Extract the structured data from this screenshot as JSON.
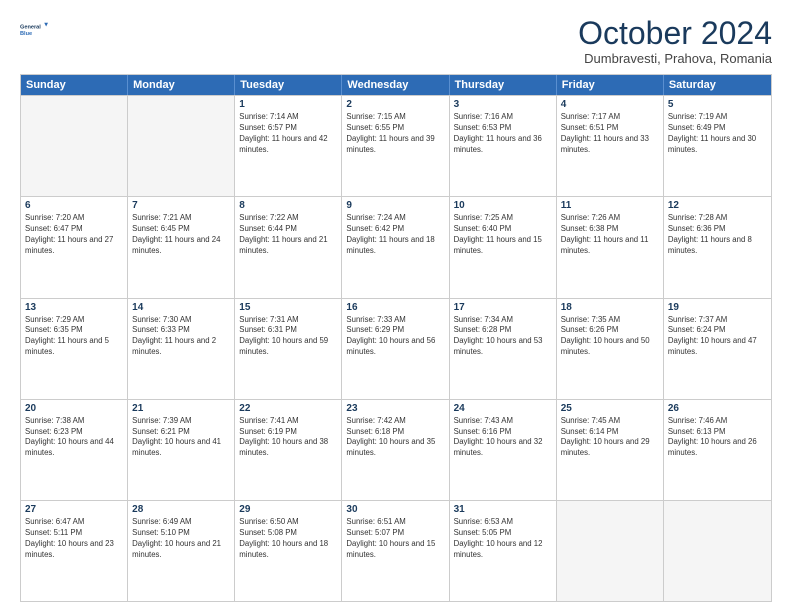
{
  "logo": {
    "line1": "General",
    "line2": "Blue"
  },
  "title": "October 2024",
  "subtitle": "Dumbravesti, Prahova, Romania",
  "days": [
    "Sunday",
    "Monday",
    "Tuesday",
    "Wednesday",
    "Thursday",
    "Friday",
    "Saturday"
  ],
  "weeks": [
    [
      {
        "day": "",
        "sunrise": "",
        "sunset": "",
        "daylight": ""
      },
      {
        "day": "",
        "sunrise": "",
        "sunset": "",
        "daylight": ""
      },
      {
        "day": "1",
        "sunrise": "Sunrise: 7:14 AM",
        "sunset": "Sunset: 6:57 PM",
        "daylight": "Daylight: 11 hours and 42 minutes."
      },
      {
        "day": "2",
        "sunrise": "Sunrise: 7:15 AM",
        "sunset": "Sunset: 6:55 PM",
        "daylight": "Daylight: 11 hours and 39 minutes."
      },
      {
        "day": "3",
        "sunrise": "Sunrise: 7:16 AM",
        "sunset": "Sunset: 6:53 PM",
        "daylight": "Daylight: 11 hours and 36 minutes."
      },
      {
        "day": "4",
        "sunrise": "Sunrise: 7:17 AM",
        "sunset": "Sunset: 6:51 PM",
        "daylight": "Daylight: 11 hours and 33 minutes."
      },
      {
        "day": "5",
        "sunrise": "Sunrise: 7:19 AM",
        "sunset": "Sunset: 6:49 PM",
        "daylight": "Daylight: 11 hours and 30 minutes."
      }
    ],
    [
      {
        "day": "6",
        "sunrise": "Sunrise: 7:20 AM",
        "sunset": "Sunset: 6:47 PM",
        "daylight": "Daylight: 11 hours and 27 minutes."
      },
      {
        "day": "7",
        "sunrise": "Sunrise: 7:21 AM",
        "sunset": "Sunset: 6:45 PM",
        "daylight": "Daylight: 11 hours and 24 minutes."
      },
      {
        "day": "8",
        "sunrise": "Sunrise: 7:22 AM",
        "sunset": "Sunset: 6:44 PM",
        "daylight": "Daylight: 11 hours and 21 minutes."
      },
      {
        "day": "9",
        "sunrise": "Sunrise: 7:24 AM",
        "sunset": "Sunset: 6:42 PM",
        "daylight": "Daylight: 11 hours and 18 minutes."
      },
      {
        "day": "10",
        "sunrise": "Sunrise: 7:25 AM",
        "sunset": "Sunset: 6:40 PM",
        "daylight": "Daylight: 11 hours and 15 minutes."
      },
      {
        "day": "11",
        "sunrise": "Sunrise: 7:26 AM",
        "sunset": "Sunset: 6:38 PM",
        "daylight": "Daylight: 11 hours and 11 minutes."
      },
      {
        "day": "12",
        "sunrise": "Sunrise: 7:28 AM",
        "sunset": "Sunset: 6:36 PM",
        "daylight": "Daylight: 11 hours and 8 minutes."
      }
    ],
    [
      {
        "day": "13",
        "sunrise": "Sunrise: 7:29 AM",
        "sunset": "Sunset: 6:35 PM",
        "daylight": "Daylight: 11 hours and 5 minutes."
      },
      {
        "day": "14",
        "sunrise": "Sunrise: 7:30 AM",
        "sunset": "Sunset: 6:33 PM",
        "daylight": "Daylight: 11 hours and 2 minutes."
      },
      {
        "day": "15",
        "sunrise": "Sunrise: 7:31 AM",
        "sunset": "Sunset: 6:31 PM",
        "daylight": "Daylight: 10 hours and 59 minutes."
      },
      {
        "day": "16",
        "sunrise": "Sunrise: 7:33 AM",
        "sunset": "Sunset: 6:29 PM",
        "daylight": "Daylight: 10 hours and 56 minutes."
      },
      {
        "day": "17",
        "sunrise": "Sunrise: 7:34 AM",
        "sunset": "Sunset: 6:28 PM",
        "daylight": "Daylight: 10 hours and 53 minutes."
      },
      {
        "day": "18",
        "sunrise": "Sunrise: 7:35 AM",
        "sunset": "Sunset: 6:26 PM",
        "daylight": "Daylight: 10 hours and 50 minutes."
      },
      {
        "day": "19",
        "sunrise": "Sunrise: 7:37 AM",
        "sunset": "Sunset: 6:24 PM",
        "daylight": "Daylight: 10 hours and 47 minutes."
      }
    ],
    [
      {
        "day": "20",
        "sunrise": "Sunrise: 7:38 AM",
        "sunset": "Sunset: 6:23 PM",
        "daylight": "Daylight: 10 hours and 44 minutes."
      },
      {
        "day": "21",
        "sunrise": "Sunrise: 7:39 AM",
        "sunset": "Sunset: 6:21 PM",
        "daylight": "Daylight: 10 hours and 41 minutes."
      },
      {
        "day": "22",
        "sunrise": "Sunrise: 7:41 AM",
        "sunset": "Sunset: 6:19 PM",
        "daylight": "Daylight: 10 hours and 38 minutes."
      },
      {
        "day": "23",
        "sunrise": "Sunrise: 7:42 AM",
        "sunset": "Sunset: 6:18 PM",
        "daylight": "Daylight: 10 hours and 35 minutes."
      },
      {
        "day": "24",
        "sunrise": "Sunrise: 7:43 AM",
        "sunset": "Sunset: 6:16 PM",
        "daylight": "Daylight: 10 hours and 32 minutes."
      },
      {
        "day": "25",
        "sunrise": "Sunrise: 7:45 AM",
        "sunset": "Sunset: 6:14 PM",
        "daylight": "Daylight: 10 hours and 29 minutes."
      },
      {
        "day": "26",
        "sunrise": "Sunrise: 7:46 AM",
        "sunset": "Sunset: 6:13 PM",
        "daylight": "Daylight: 10 hours and 26 minutes."
      }
    ],
    [
      {
        "day": "27",
        "sunrise": "Sunrise: 6:47 AM",
        "sunset": "Sunset: 5:11 PM",
        "daylight": "Daylight: 10 hours and 23 minutes."
      },
      {
        "day": "28",
        "sunrise": "Sunrise: 6:49 AM",
        "sunset": "Sunset: 5:10 PM",
        "daylight": "Daylight: 10 hours and 21 minutes."
      },
      {
        "day": "29",
        "sunrise": "Sunrise: 6:50 AM",
        "sunset": "Sunset: 5:08 PM",
        "daylight": "Daylight: 10 hours and 18 minutes."
      },
      {
        "day": "30",
        "sunrise": "Sunrise: 6:51 AM",
        "sunset": "Sunset: 5:07 PM",
        "daylight": "Daylight: 10 hours and 15 minutes."
      },
      {
        "day": "31",
        "sunrise": "Sunrise: 6:53 AM",
        "sunset": "Sunset: 5:05 PM",
        "daylight": "Daylight: 10 hours and 12 minutes."
      },
      {
        "day": "",
        "sunrise": "",
        "sunset": "",
        "daylight": ""
      },
      {
        "day": "",
        "sunrise": "",
        "sunset": "",
        "daylight": ""
      }
    ]
  ]
}
